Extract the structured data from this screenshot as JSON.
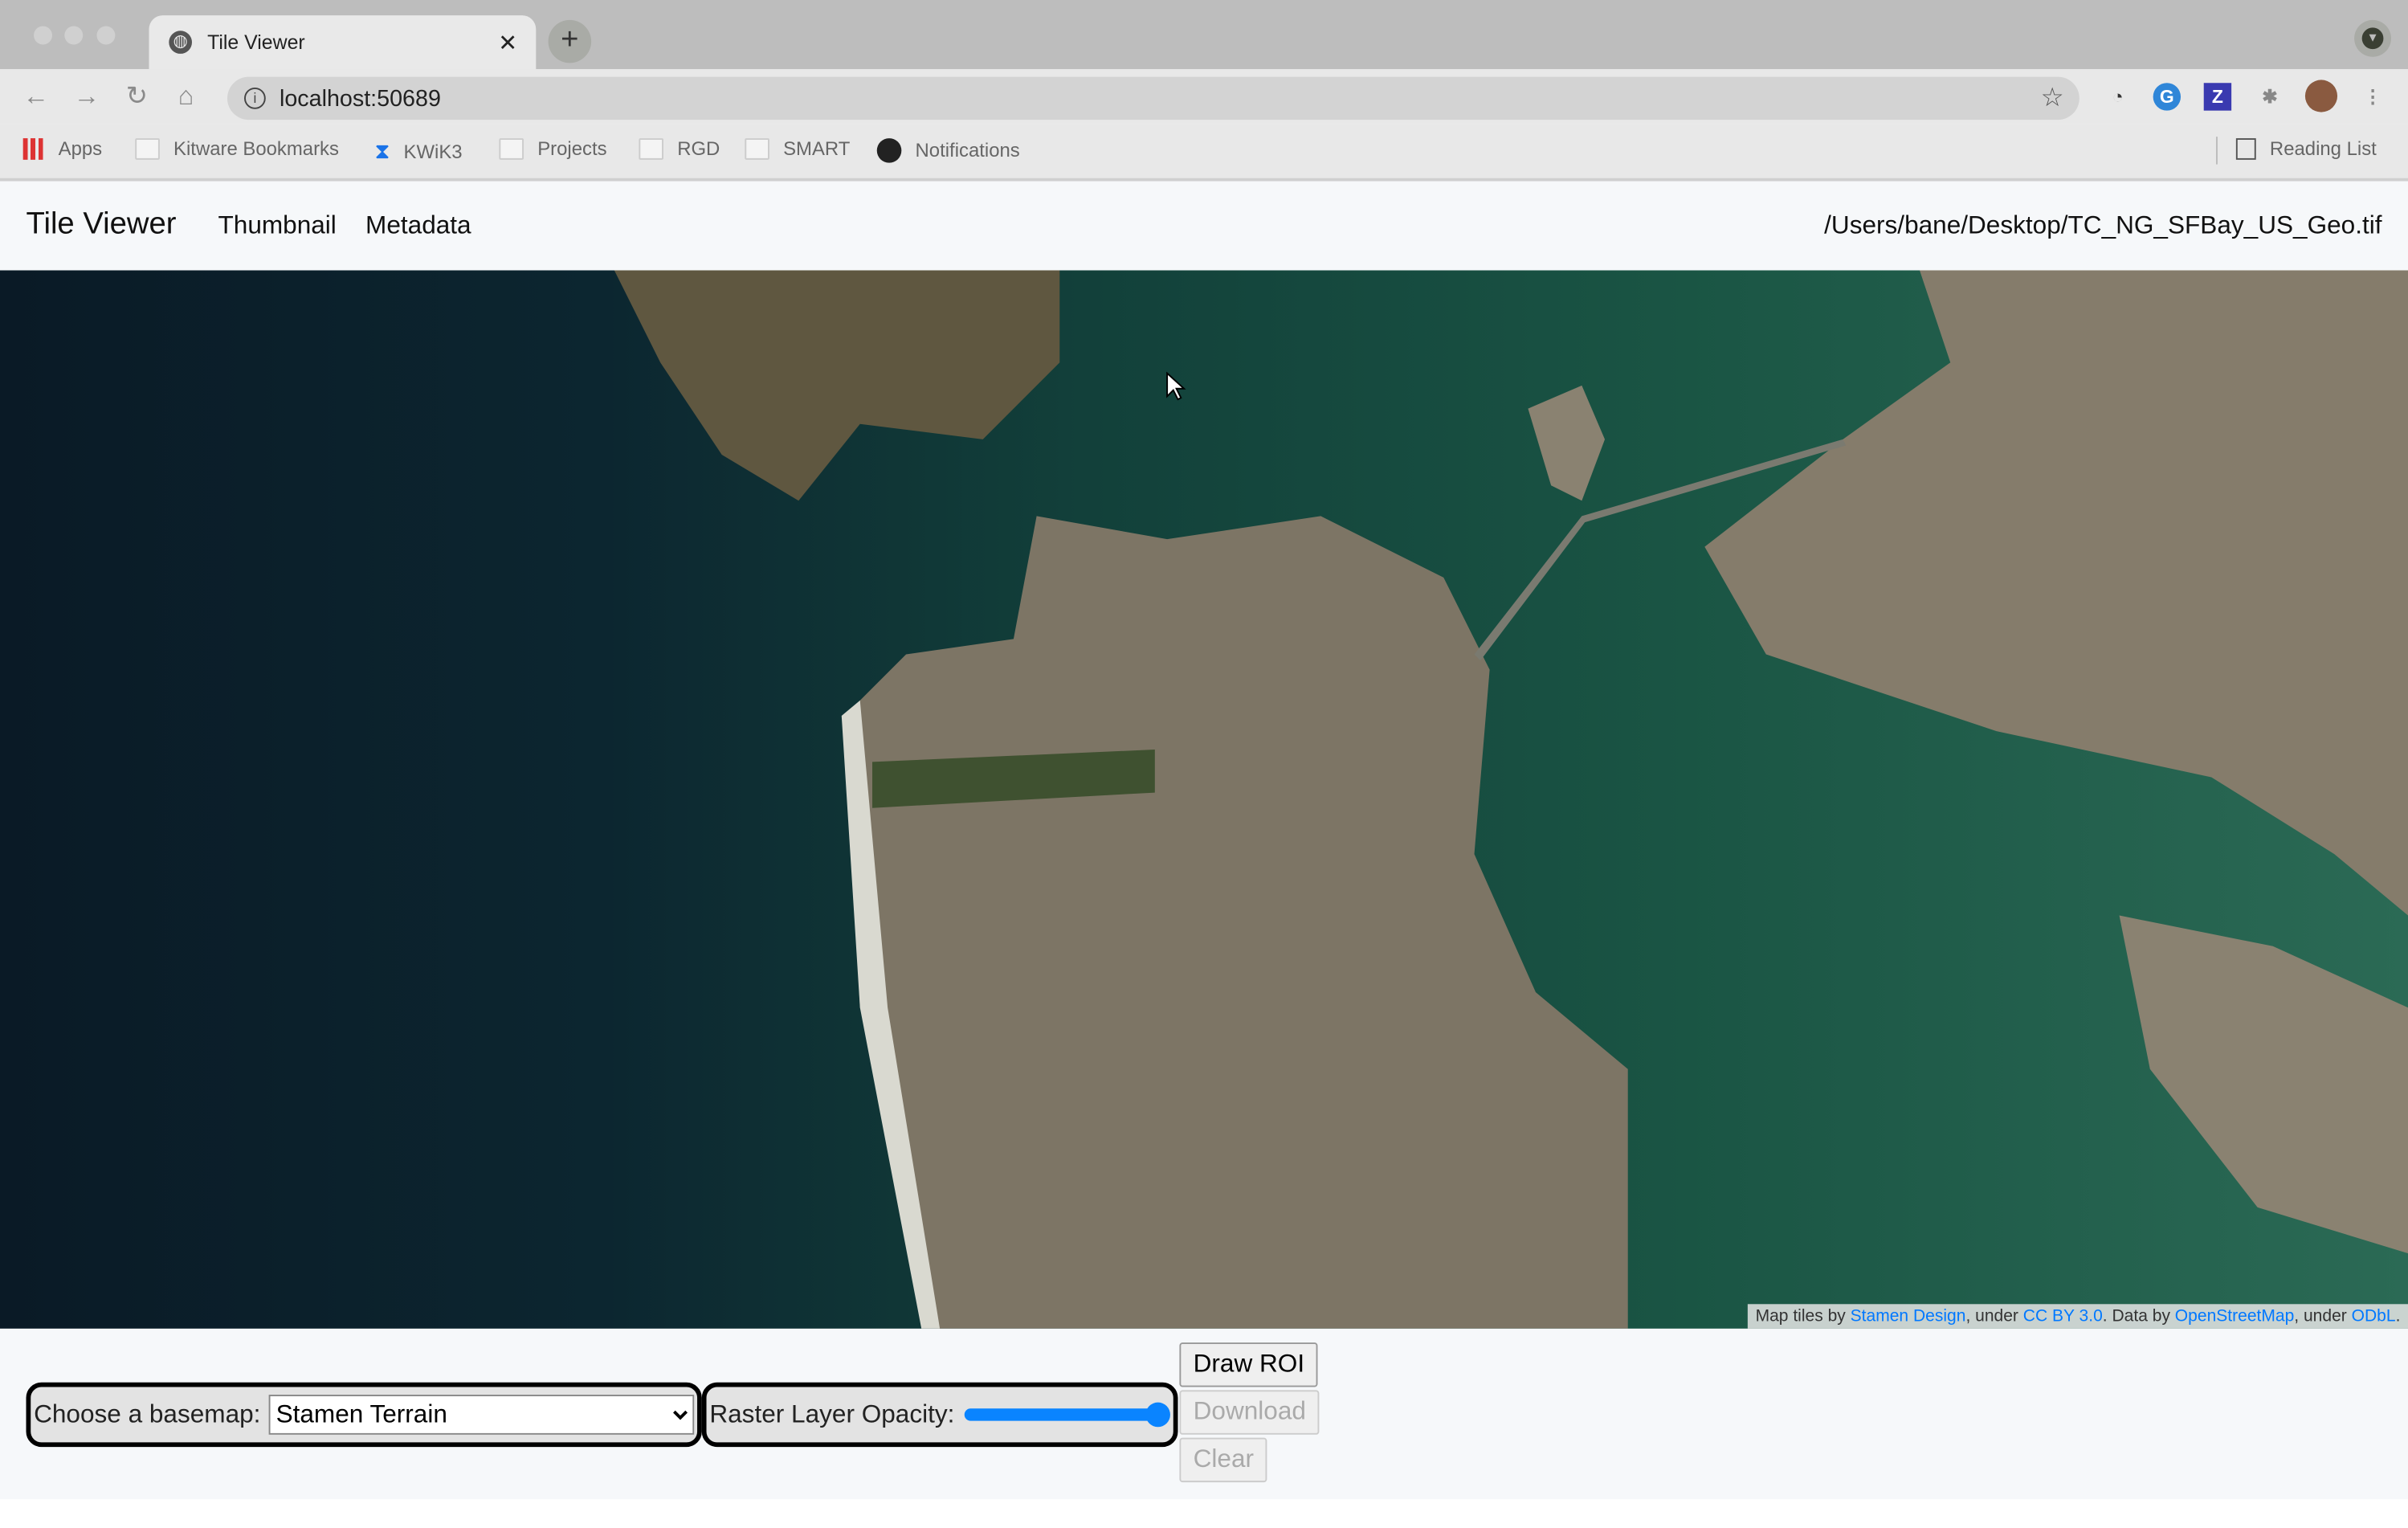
{
  "browser": {
    "tab_title": "Tile Viewer",
    "url": "localhost:50689",
    "bookmarks": [
      "Apps",
      "Kitware Bookmarks",
      "KWiK3",
      "Projects",
      "RGD",
      "SMART",
      "Notifications"
    ],
    "reading_list": "Reading List"
  },
  "header": {
    "brand": "Tile Viewer",
    "nav": [
      "Thumbnail",
      "Metadata"
    ],
    "file_path": "/Users/bane/Desktop/TC_NG_SFBay_US_Geo.tif"
  },
  "map": {
    "attribution": {
      "t1": "Map tiles by ",
      "l1": "Stamen Design",
      "t2": ", under ",
      "l2": "CC BY 3.0",
      "t3": ". Data by ",
      "l3": "OpenStreetMap",
      "t4": ", under ",
      "l4": "ODbL",
      "t5": "."
    }
  },
  "controls": {
    "basemap_label": "Choose a basemap:",
    "basemap_value": "Stamen Terrain",
    "opacity_label": "Raster Layer Opacity:",
    "opacity_value": 1.0,
    "draw_roi": "Draw ROI",
    "download": "Download",
    "clear": "Clear"
  },
  "colors": {
    "accent": "#0a84ff",
    "link": "#0078ff"
  }
}
